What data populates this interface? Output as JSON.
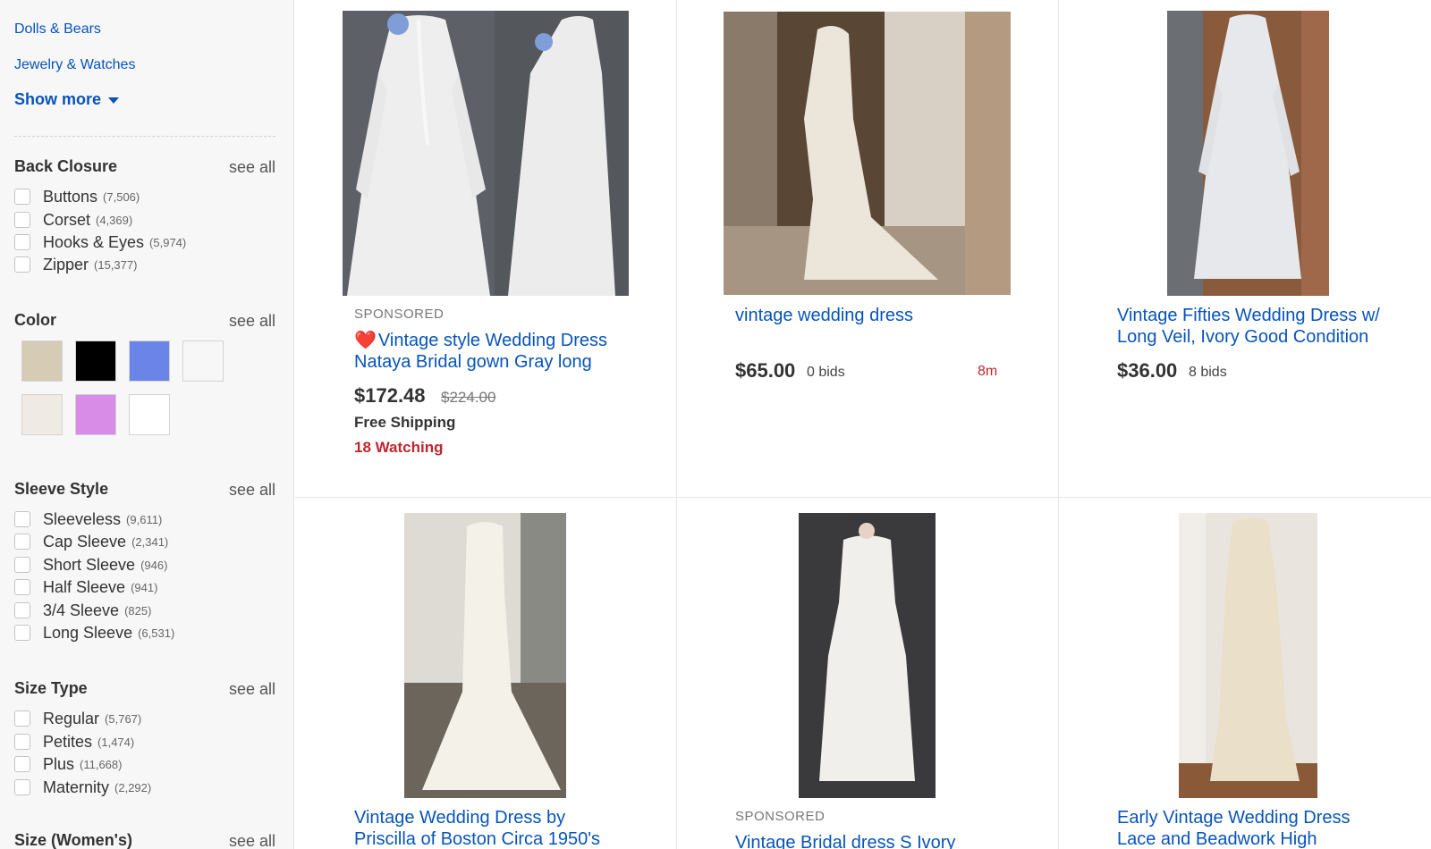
{
  "sidebar": {
    "categories": [
      "Dolls & Bears",
      "Jewelry & Watches"
    ],
    "show_more": "Show more",
    "see_all": "see all",
    "back_closure": {
      "title": "Back Closure",
      "options": [
        {
          "label": "Buttons",
          "count": "(7,506)"
        },
        {
          "label": "Corset",
          "count": "(4,369)"
        },
        {
          "label": "Hooks & Eyes",
          "count": "(5,974)"
        },
        {
          "label": "Zipper",
          "count": "(15,377)"
        }
      ]
    },
    "color": {
      "title": "Color",
      "swatches": [
        "#d6cbb4",
        "#000000",
        "#6b84e8",
        "#f7f7f7",
        "#efebe4",
        "#d98be8",
        "#ffffff"
      ]
    },
    "sleeve_style": {
      "title": "Sleeve Style",
      "options": [
        {
          "label": "Sleeveless",
          "count": "(9,611)"
        },
        {
          "label": "Cap Sleeve",
          "count": "(2,341)"
        },
        {
          "label": "Short Sleeve",
          "count": "(946)"
        },
        {
          "label": "Half Sleeve",
          "count": "(941)"
        },
        {
          "label": "3/4 Sleeve",
          "count": "(825)"
        },
        {
          "label": "Long Sleeve",
          "count": "(6,531)"
        }
      ]
    },
    "size_type": {
      "title": "Size Type",
      "options": [
        {
          "label": "Regular",
          "count": "(5,767)"
        },
        {
          "label": "Petites",
          "count": "(1,474)"
        },
        {
          "label": "Plus",
          "count": "(11,668)"
        },
        {
          "label": "Maternity",
          "count": "(2,292)"
        }
      ]
    },
    "size_womens": {
      "title": "Size (Women's)"
    }
  },
  "items": [
    {
      "sponsored": "SPONSORED",
      "heart": "❤️",
      "title_line1": "Vintage style Wedding Dress",
      "title_line2": "Nataya Bridal gown Gray long",
      "price": "$172.48",
      "orig_price": "$224.00",
      "shipping": "Free Shipping",
      "watching": "18 Watching"
    },
    {
      "title_line1": "vintage wedding dress",
      "price": "$65.00",
      "bids": "0 bids",
      "time_left": "8m"
    },
    {
      "title_line1": "Vintage Fifties Wedding Dress w/",
      "title_line2": "Long Veil, Ivory Good Condition",
      "price": "$36.00",
      "bids": "8 bids"
    },
    {
      "title_line1": "Vintage Wedding Dress by",
      "title_line2": "Priscilla of Boston Circa 1950's"
    },
    {
      "sponsored": "SPONSORED",
      "title_line1": "Vintage Bridal dress S Ivory"
    },
    {
      "title_line1": "Early Vintage Wedding Dress",
      "title_line2": "Lace and Beadwork High"
    }
  ]
}
